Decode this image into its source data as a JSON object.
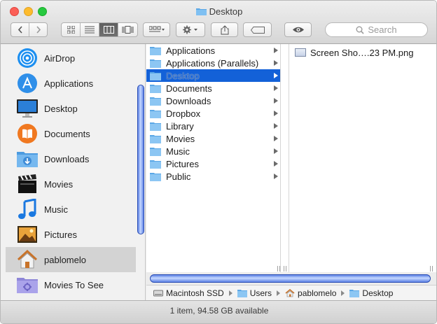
{
  "window": {
    "title": "Desktop"
  },
  "toolbar": {
    "search_placeholder": "Search"
  },
  "sidebar": {
    "items": [
      {
        "label": "AirDrop",
        "icon": "airdrop-icon"
      },
      {
        "label": "Applications",
        "icon": "applications-icon"
      },
      {
        "label": "Desktop",
        "icon": "desktop-icon"
      },
      {
        "label": "Documents",
        "icon": "documents-icon"
      },
      {
        "label": "Downloads",
        "icon": "downloads-icon"
      },
      {
        "label": "Movies",
        "icon": "movies-icon"
      },
      {
        "label": "Music",
        "icon": "music-icon"
      },
      {
        "label": "Pictures",
        "icon": "pictures-icon"
      },
      {
        "label": "pablomelo",
        "icon": "home-icon"
      },
      {
        "label": "Movies To See",
        "icon": "smart-folder-icon"
      }
    ],
    "selected_index": 8
  },
  "column1": {
    "items": [
      "Applications",
      "Applications (Parallels)",
      "Desktop",
      "Documents",
      "Downloads",
      "Dropbox",
      "Library",
      "Movies",
      "Music",
      "Pictures",
      "Public"
    ],
    "selected_index": 2
  },
  "column2": {
    "files": [
      "Screen Sho….23 PM.png"
    ]
  },
  "pathbar": {
    "crumbs": [
      "Macintosh SSD",
      "Users",
      "pablomelo",
      "Desktop"
    ]
  },
  "status": {
    "text": "1 item, 94.58 GB available"
  },
  "colors": {
    "selection": "#1361d8",
    "folder": "#5aa7e6",
    "scroll": "#5d82e6"
  }
}
